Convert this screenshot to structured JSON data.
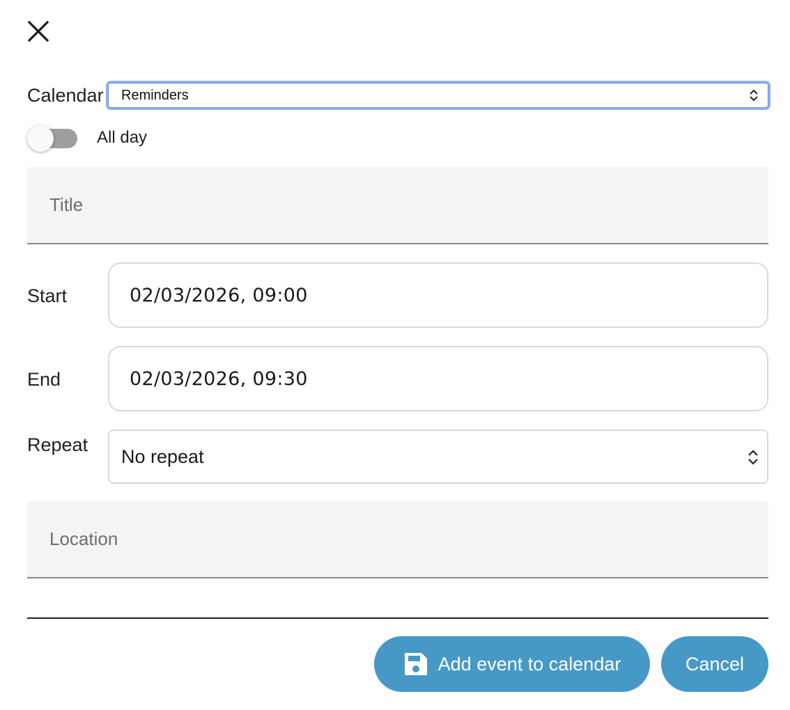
{
  "dialog": {
    "calendar": {
      "label": "Calendar",
      "selected": "Reminders"
    },
    "all_day": {
      "label": "All day",
      "enabled": false
    },
    "title": {
      "placeholder": "Title",
      "value": ""
    },
    "start": {
      "label": "Start",
      "value": "02/03/2026, 09:00"
    },
    "end": {
      "label": "End",
      "value": "02/03/2026, 09:30"
    },
    "repeat": {
      "label": "Repeat",
      "selected": "No repeat"
    },
    "location": {
      "placeholder": "Location",
      "value": ""
    },
    "actions": {
      "add_label": "Add event to calendar",
      "cancel_label": "Cancel"
    },
    "icons": {
      "close": "close-icon",
      "chevron": "unfold-chevron-icon",
      "save": "floppy-disk-icon"
    },
    "colors": {
      "primary": "#4699c7",
      "focus_ring": "#8fb0f2",
      "toggle_off_track": "#9e9e9e",
      "field_fill": "#f4f4f4"
    }
  }
}
